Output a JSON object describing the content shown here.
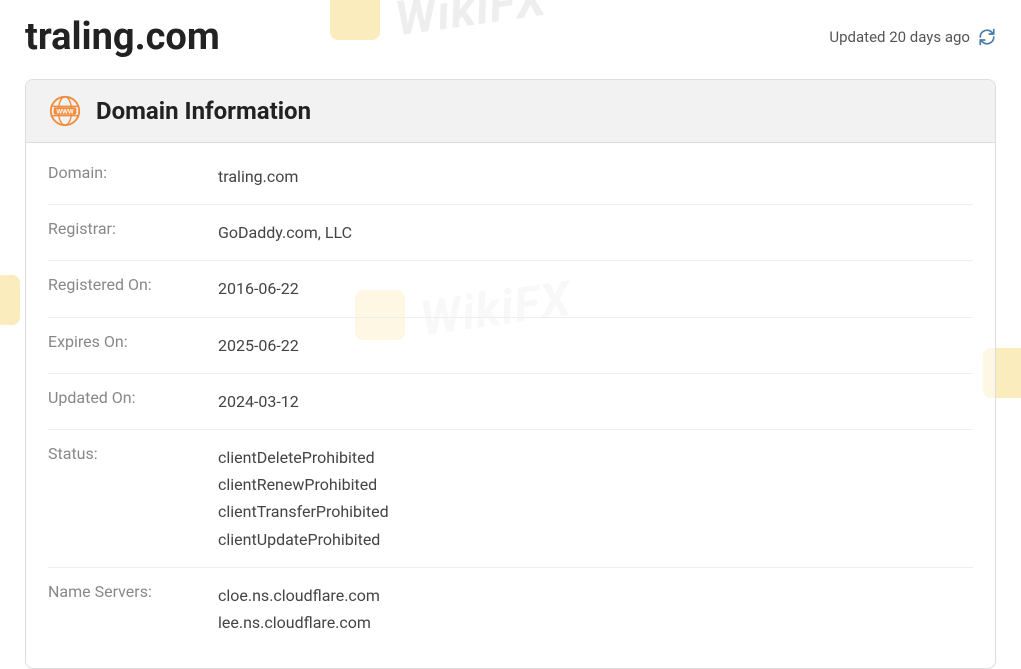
{
  "header": {
    "domain_title": "traling.com",
    "updated_text": "Updated 20 days ago"
  },
  "card": {
    "title": "Domain Information"
  },
  "rows": [
    {
      "label": "Domain:",
      "value": "traling.com"
    },
    {
      "label": "Registrar:",
      "value": "GoDaddy.com, LLC"
    },
    {
      "label": "Registered On:",
      "value": "2016-06-22"
    },
    {
      "label": "Expires On:",
      "value": "2025-06-22"
    },
    {
      "label": "Updated On:",
      "value": "2024-03-12"
    },
    {
      "label": "Status:",
      "value": "clientDeleteProhibited\nclientRenewProhibited\nclientTransferProhibited\nclientUpdateProhibited"
    },
    {
      "label": "Name Servers:",
      "value": "cloe.ns.cloudflare.com\nlee.ns.cloudflare.com"
    }
  ],
  "watermark": {
    "text": "WikiFX"
  }
}
